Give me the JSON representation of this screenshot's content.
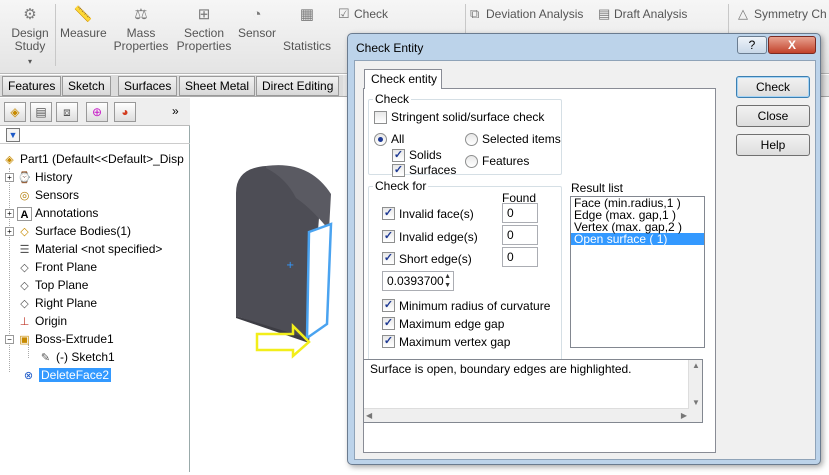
{
  "ribbon": {
    "design_study_line1": "Design",
    "design_study_line2": "Study",
    "measure": "Measure",
    "mass_props_line1": "Mass",
    "mass_props_line2": "Properties",
    "section_props_line1": "Section",
    "section_props_line2": "Properties",
    "sensor": "Sensor",
    "statistics": "Statistics",
    "check": "Check",
    "deviation_analysis": "Deviation Analysis",
    "draft_analysis": "Draft Analysis",
    "symmetry_check": "Symmetry Ch"
  },
  "tabs": [
    "Features",
    "Sketch",
    "Surfaces",
    "Sheet Metal",
    "Direct Editing"
  ],
  "tree": {
    "root": "Part1  (Default<<Default>_Disp",
    "items": [
      "History",
      "Sensors",
      "Annotations",
      "Surface Bodies(1)",
      "Material <not specified>",
      "Front Plane",
      "Top Plane",
      "Right Plane",
      "Origin",
      "Boss-Extrude1",
      "(-) Sketch1",
      "DeleteFace2"
    ]
  },
  "dialog": {
    "title": "Check Entity",
    "help_q": "?",
    "close_x": "X",
    "tab": "Check entity",
    "check_group": "Check",
    "stringent": "Stringent solid/surface check",
    "all": "All",
    "solids": "Solids",
    "surfaces": "Surfaces",
    "selected_items": "Selected items",
    "features": "Features",
    "check_for_group": "Check for",
    "found_header": "Found",
    "invalid_face": "Invalid face(s)",
    "invalid_face_count": "0",
    "invalid_edge": "Invalid edge(s)",
    "invalid_edge_count": "0",
    "short_edge": "Short edge(s)",
    "short_edge_count": "0",
    "short_edge_value": "0.0393700",
    "min_radius": "Minimum radius of curvature",
    "max_edge_gap": "Maximum edge gap",
    "max_vertex_gap": "Maximum vertex gap",
    "result_list_label": "Result list",
    "results": [
      "Face (min.radius,1  )",
      "Edge (max. gap,1  )",
      "Vertex (max. gap,2  )",
      "Open surface ( 1)"
    ],
    "message": "Surface is open, boundary edges are highlighted.",
    "btn_check": "Check",
    "btn_close": "Close",
    "btn_help": "Help"
  },
  "colors": {
    "selection": "#3399ff",
    "dialog_frame": "#bcd3ea",
    "highlight_edge": "#4aa3f0",
    "arrow": "#f2ee1a"
  }
}
